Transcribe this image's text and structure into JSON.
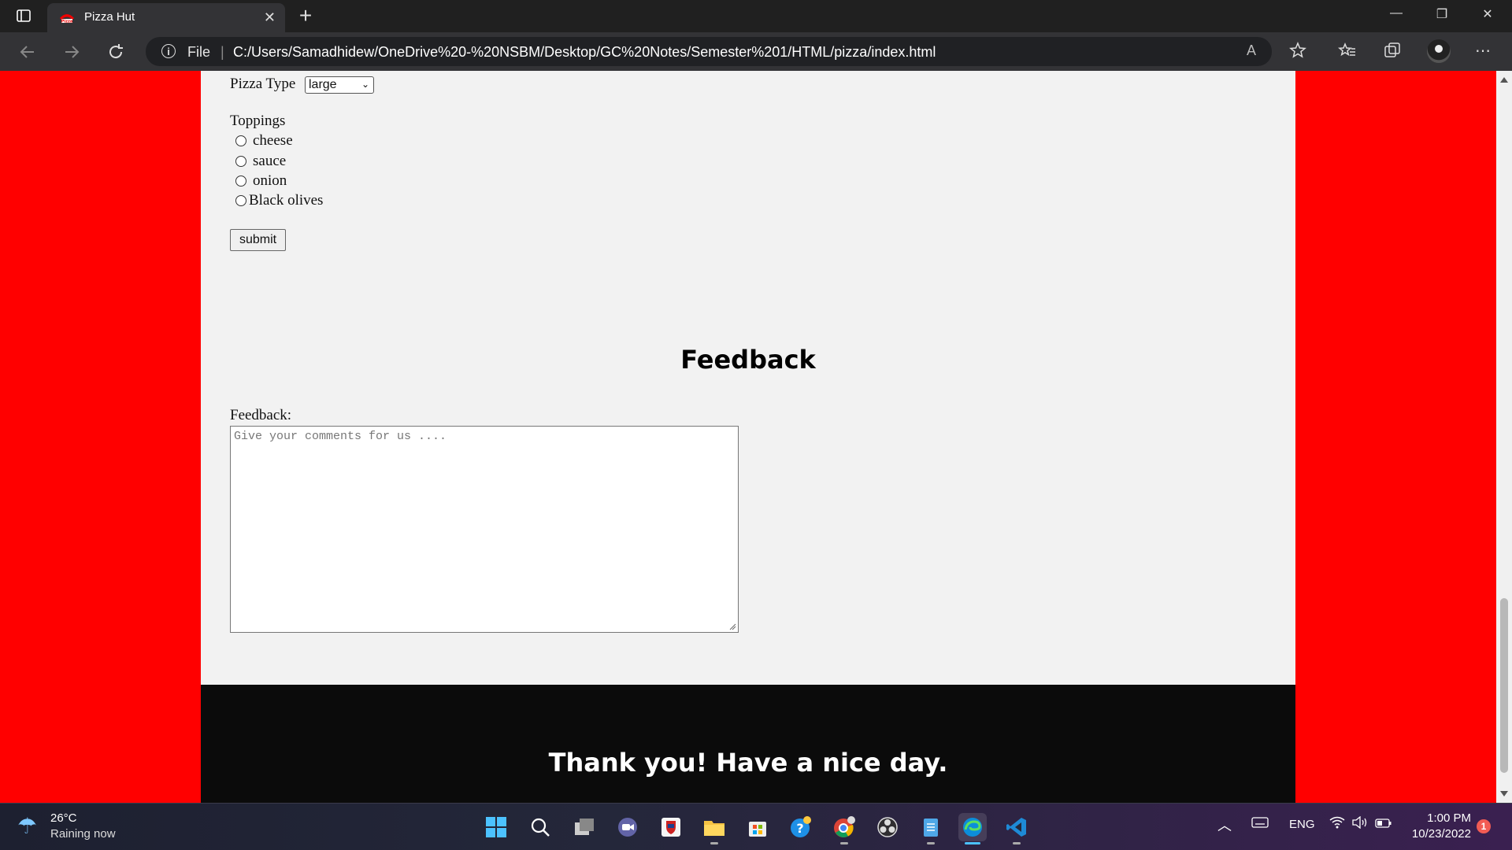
{
  "browser": {
    "tab_title": "Pizza Hut",
    "tab_close": "✕",
    "new_tab": "+",
    "address_prefix": "File",
    "address_separator": "|",
    "url": "C:/Users/Samadhidew/OneDrive%20-%20NSBM/Desktop/GC%20Notes/Semester%201/HTML/pizza/index.html",
    "read_aloud_icon": "A",
    "window_minimize": "—",
    "window_restore": "❐",
    "window_close": "✕"
  },
  "form": {
    "pizza_type_label": "Pizza Type",
    "pizza_type_value": "large",
    "toppings_label": "Toppings",
    "toppings": [
      "cheese",
      "sauce",
      "onion",
      "Black olives"
    ],
    "submit_label": "submit"
  },
  "feedback": {
    "title": "Feedback",
    "label": "Feedback:",
    "placeholder": "Give your comments for us ...."
  },
  "footer": {
    "text": "Thank you! Have a nice day."
  },
  "taskbar": {
    "temperature": "26°C",
    "condition": "Raining now",
    "language": "ENG",
    "time": "1:00 PM",
    "date": "10/23/2022",
    "notification_count": "1"
  },
  "colors": {
    "page_background": "#ff0000",
    "container_background": "#f2f2f2",
    "footer_background": "#0b0b0b"
  }
}
